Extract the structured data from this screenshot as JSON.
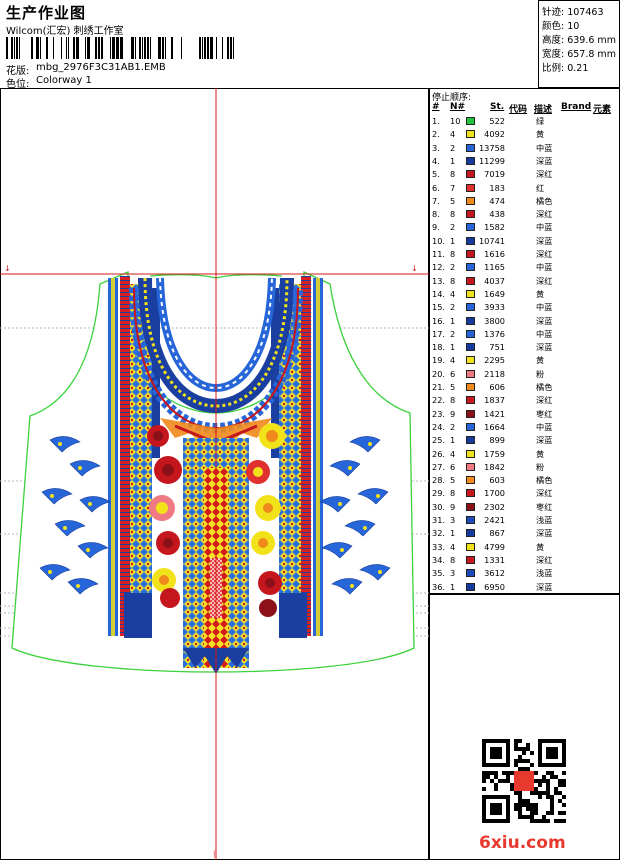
{
  "header": {
    "title": "生产作业图",
    "company": "Wilcom(汇宏) 刺绣工作室",
    "design_label": "花版:",
    "design_file": "mbg_2976F3C31AB1.EMB",
    "colorway_label": "色位:",
    "colorway": "Colorway 1"
  },
  "stats": {
    "stitches": "针迹: 107463",
    "colors": "颜色: 10",
    "height": "高度: 639.6 mm",
    "width": "宽度: 657.8 mm",
    "ratio": "比例: 0.21"
  },
  "stop_sequence": {
    "title": "停止顺序:",
    "columns": {
      "idx": "#",
      "needle": "N#",
      "st": "St.",
      "code": "代码",
      "desc": "描述",
      "brand": "Brand",
      "element": "元素"
    },
    "rows": [
      {
        "idx": "1.",
        "needle": "10",
        "st": "522",
        "desc": "绿",
        "color": "#22c33a"
      },
      {
        "idx": "2.",
        "needle": "4",
        "st": "4092",
        "desc": "黄",
        "color": "#f2e21a"
      },
      {
        "idx": "3.",
        "needle": "2",
        "st": "13758",
        "desc": "中蓝",
        "color": "#2766d8"
      },
      {
        "idx": "4.",
        "needle": "1",
        "st": "11299",
        "desc": "深蓝",
        "color": "#163a9c"
      },
      {
        "idx": "5.",
        "needle": "8",
        "st": "7019",
        "desc": "深红",
        "color": "#c4161c"
      },
      {
        "idx": "6.",
        "needle": "7",
        "st": "183",
        "desc": "红",
        "color": "#e03030"
      },
      {
        "idx": "7.",
        "needle": "5",
        "st": "474",
        "desc": "橘色",
        "color": "#f08a1c"
      },
      {
        "idx": "8.",
        "needle": "8",
        "st": "438",
        "desc": "深红",
        "color": "#c4161c"
      },
      {
        "idx": "9.",
        "needle": "2",
        "st": "1582",
        "desc": "中蓝",
        "color": "#2766d8"
      },
      {
        "idx": "10.",
        "needle": "1",
        "st": "10741",
        "desc": "深蓝",
        "color": "#163a9c"
      },
      {
        "idx": "11.",
        "needle": "8",
        "st": "1616",
        "desc": "深红",
        "color": "#c4161c"
      },
      {
        "idx": "12.",
        "needle": "2",
        "st": "1165",
        "desc": "中蓝",
        "color": "#2766d8"
      },
      {
        "idx": "13.",
        "needle": "8",
        "st": "4037",
        "desc": "深红",
        "color": "#c4161c"
      },
      {
        "idx": "14.",
        "needle": "4",
        "st": "1649",
        "desc": "黄",
        "color": "#f2e21a"
      },
      {
        "idx": "15.",
        "needle": "2",
        "st": "3933",
        "desc": "中蓝",
        "color": "#2766d8"
      },
      {
        "idx": "16.",
        "needle": "1",
        "st": "3800",
        "desc": "深蓝",
        "color": "#163a9c"
      },
      {
        "idx": "17.",
        "needle": "2",
        "st": "1376",
        "desc": "中蓝",
        "color": "#2766d8"
      },
      {
        "idx": "18.",
        "needle": "1",
        "st": "751",
        "desc": "深蓝",
        "color": "#163a9c"
      },
      {
        "idx": "19.",
        "needle": "4",
        "st": "2295",
        "desc": "黄",
        "color": "#f2e21a"
      },
      {
        "idx": "20.",
        "needle": "6",
        "st": "2118",
        "desc": "粉",
        "color": "#f07a84"
      },
      {
        "idx": "21.",
        "needle": "5",
        "st": "606",
        "desc": "橘色",
        "color": "#f08a1c"
      },
      {
        "idx": "22.",
        "needle": "8",
        "st": "1837",
        "desc": "深红",
        "color": "#c4161c"
      },
      {
        "idx": "23.",
        "needle": "9",
        "st": "1421",
        "desc": "枣红",
        "color": "#8c1018"
      },
      {
        "idx": "24.",
        "needle": "2",
        "st": "1664",
        "desc": "中蓝",
        "color": "#2766d8"
      },
      {
        "idx": "25.",
        "needle": "1",
        "st": "899",
        "desc": "深蓝",
        "color": "#163a9c"
      },
      {
        "idx": "26.",
        "needle": "4",
        "st": "1759",
        "desc": "黄",
        "color": "#f2e21a"
      },
      {
        "idx": "27.",
        "needle": "6",
        "st": "1842",
        "desc": "粉",
        "color": "#f07a84"
      },
      {
        "idx": "28.",
        "needle": "5",
        "st": "603",
        "desc": "橘色",
        "color": "#f08a1c"
      },
      {
        "idx": "29.",
        "needle": "8",
        "st": "1700",
        "desc": "深红",
        "color": "#c4161c"
      },
      {
        "idx": "30.",
        "needle": "9",
        "st": "2302",
        "desc": "枣红",
        "color": "#8c1018"
      },
      {
        "idx": "31.",
        "needle": "3",
        "st": "2421",
        "desc": "浅蓝",
        "color": "#1f48b8"
      },
      {
        "idx": "32.",
        "needle": "1",
        "st": "867",
        "desc": "深蓝",
        "color": "#163a9c"
      },
      {
        "idx": "33.",
        "needle": "4",
        "st": "4799",
        "desc": "黄",
        "color": "#f2e21a"
      },
      {
        "idx": "34.",
        "needle": "8",
        "st": "1331",
        "desc": "深红",
        "color": "#c4161c"
      },
      {
        "idx": "35.",
        "needle": "3",
        "st": "3612",
        "desc": "浅蓝",
        "color": "#1f48b8"
      },
      {
        "idx": "36.",
        "needle": "1",
        "st": "6950",
        "desc": "深蓝",
        "color": "#163a9c"
      }
    ]
  },
  "watermark": "6xiu.com",
  "colors": {
    "guide_red": "#d21818",
    "outline_green": "#3bd23b",
    "dashed_gray": "#b9b9b9"
  }
}
